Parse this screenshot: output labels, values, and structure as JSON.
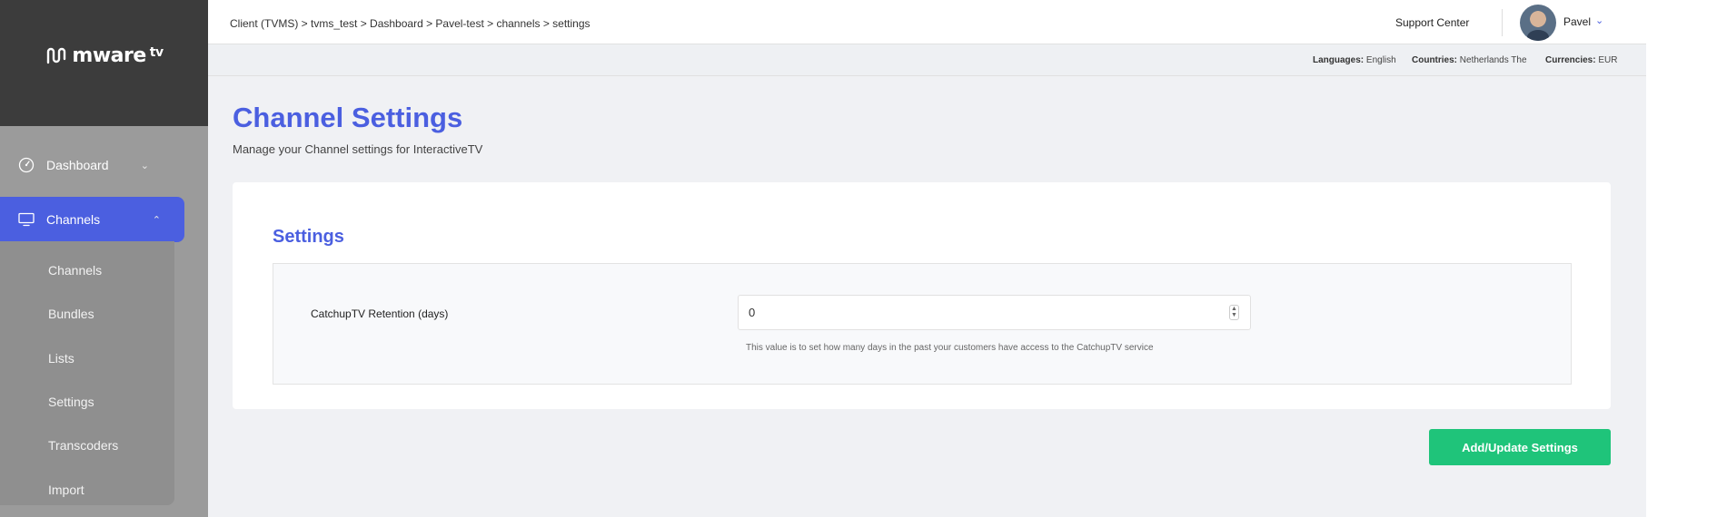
{
  "brand": {
    "logo_text": "mware",
    "logo_sup": "tv"
  },
  "sidebar": {
    "items": [
      {
        "label": "Dashboard",
        "icon": "speedometer-icon",
        "expanded": false
      },
      {
        "label": "Channels",
        "icon": "monitor-icon",
        "expanded": true,
        "active": true
      }
    ],
    "submenu": [
      "Channels",
      "Bundles",
      "Lists",
      "Settings",
      "Transcoders",
      "Import"
    ]
  },
  "header": {
    "breadcrumb": "Client (TVMS)  > tvms_test  >  Dashboard  > Pavel-test > channels > settings",
    "support": "Support Center",
    "user": "Pavel"
  },
  "infobar": {
    "languages_label": "Languages:",
    "languages_value": "English",
    "countries_label": "Countries:",
    "countries_value": "Netherlands The",
    "currencies_label": "Currencies:",
    "currencies_value": "EUR"
  },
  "page": {
    "title": "Channel Settings",
    "subtitle": "Manage your Channel settings for InteractiveTV"
  },
  "settings": {
    "title": "Settings",
    "field_label": "CatchupTV Retention (days)",
    "field_value": "0",
    "hint": "This value is to set how many days in the past your customers have access to the CatchupTV service"
  },
  "actions": {
    "submit": "Add/Update Settings"
  },
  "colors": {
    "accent": "#4b5fe0",
    "success": "#1fc47a",
    "sidebar": "#9b9b9b",
    "logo_bg": "#3c3c3c"
  }
}
